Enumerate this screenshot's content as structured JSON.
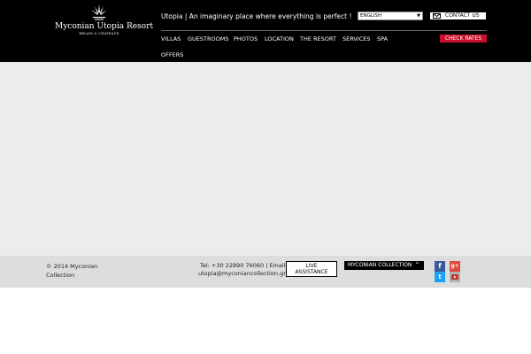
{
  "header": {
    "logo": {
      "name": "Myconian Utopia Resort",
      "sub": "RELAIS & CHATEAUX"
    },
    "tagline": "Utopia | An imaginary place where everything is perfect !",
    "language": {
      "selected": "ENGLISH"
    },
    "contact_label": "CONTACT US",
    "nav": [
      {
        "label": "VILLAS"
      },
      {
        "label": "GUESTROOMS"
      },
      {
        "label": "PHOTOS"
      },
      {
        "label": "LOCATION"
      },
      {
        "label": "THE RESORT"
      },
      {
        "label": "SERVICES"
      },
      {
        "label": "SPA"
      },
      {
        "label": "OFFERS"
      }
    ],
    "check_rates_label": "CHECK RATES"
  },
  "footer": {
    "copyright_line1": "© 2014 Myconian",
    "copyright_line2": "Collection",
    "phone": "Tel: +30 22890 76060 | Email:",
    "email": "utopia@myconiancollection.gr",
    "live_assistance_line1": "LIVE",
    "live_assistance_line2": "ASSISTANCE",
    "collection_label": "MYCONIAN COLLECTION",
    "social": [
      "facebook-icon",
      "google-plus-icon",
      "twitter-icon",
      "youtube-icon"
    ]
  },
  "colors": {
    "header_bg": "#000000",
    "accent_red": "#c8102e",
    "main_bg": "#ececec",
    "footer_bg": "#dddddd"
  }
}
